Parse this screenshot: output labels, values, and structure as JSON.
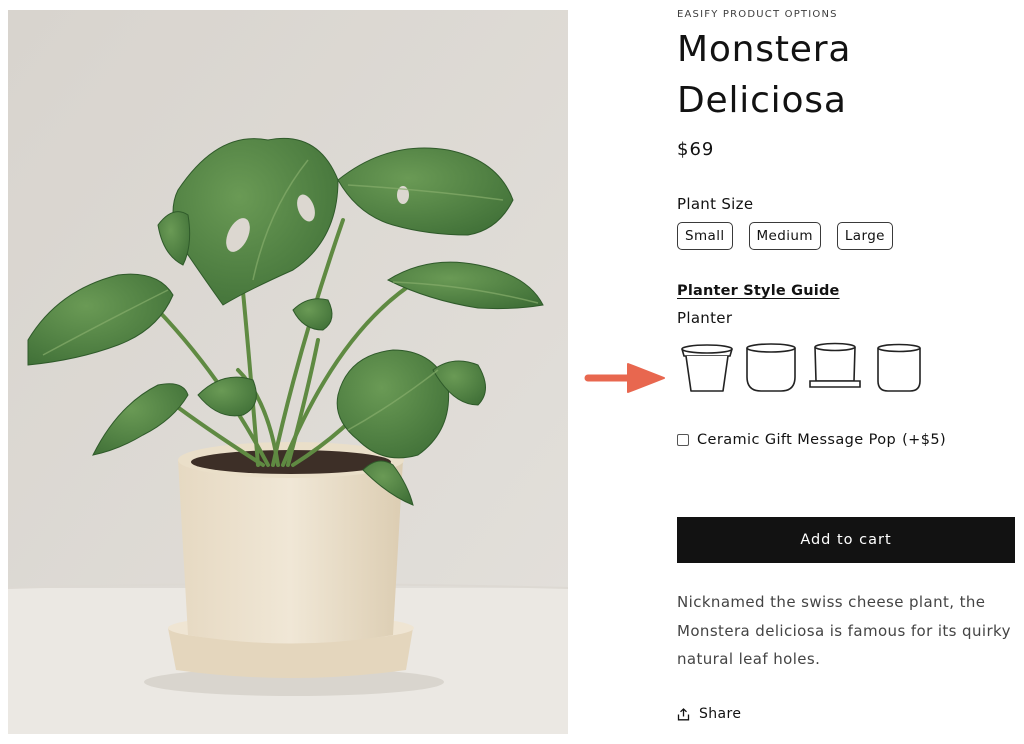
{
  "product": {
    "vendor": "EASIFY PRODUCT OPTIONS",
    "title": "Monstera Deliciosa",
    "price": "$69",
    "image": {
      "subject": "monstera-plant-in-cream-pot"
    }
  },
  "options": {
    "size_label": "Plant Size",
    "sizes": [
      {
        "label": "Small"
      },
      {
        "label": "Medium"
      },
      {
        "label": "Large"
      }
    ],
    "style_guide_link": "Planter Style Guide",
    "planter_label": "Planter",
    "planters": [
      {
        "icon": "tapered-rim-planter-icon"
      },
      {
        "icon": "round-bowl-planter-icon"
      },
      {
        "icon": "saucer-planter-icon"
      },
      {
        "icon": "cylinder-planter-icon"
      }
    ],
    "gift": {
      "label": "Ceramic Gift Message Pop",
      "extra": "(+$5)",
      "checked": false
    }
  },
  "actions": {
    "add_to_cart": "Add to cart",
    "share": "Share"
  },
  "description": "Nicknamed the swiss cheese plant, the Monstera deliciosa is famous for its quirky natural leaf holes.",
  "annotation": {
    "arrow_color": "#e8674f",
    "points_to": "planter-options"
  }
}
